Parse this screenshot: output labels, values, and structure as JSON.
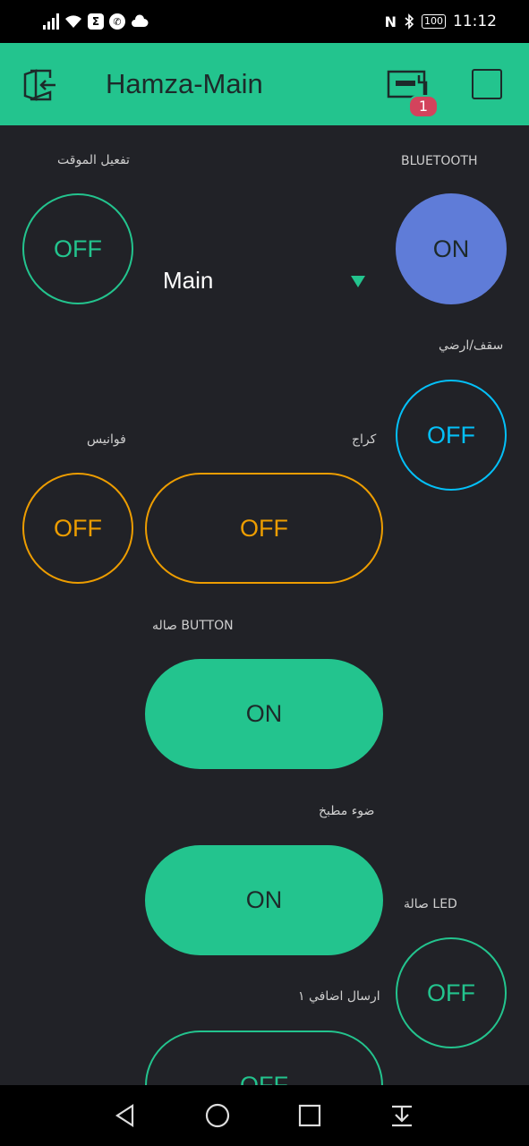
{
  "status_bar": {
    "time": "11:12",
    "battery": "100"
  },
  "header": {
    "title": "Hamza-Main",
    "device_badge": "1"
  },
  "widgets": {
    "timer_label": "تفعيل الموقت",
    "timer_state": "OFF",
    "bluetooth_label": "BLUETOOTH",
    "bluetooth_state": "ON",
    "menu_value": "Main",
    "ceiling_floor_label": "سقف/ارضي",
    "ceiling_floor_state": "OFF",
    "lanterns_label": "فوانيس",
    "lanterns_state": "OFF",
    "garage_label": "كراج",
    "garage_state": "OFF",
    "hall_button_label": "صاله  BUTTON",
    "hall_button_state": "ON",
    "kitchen_label": "ضوء مطبخ",
    "kitchen_state": "ON",
    "hall_led_label": "صالة LED",
    "hall_led_state": "OFF",
    "extra_send_label": "ارسال اضافي ١",
    "extra_send_state": "OFF"
  },
  "colors": {
    "accent_green": "#23c48e",
    "blue": "#5f7cd8",
    "cyan": "#04c0f8",
    "orange": "#ed9d00",
    "background": "#212227"
  }
}
